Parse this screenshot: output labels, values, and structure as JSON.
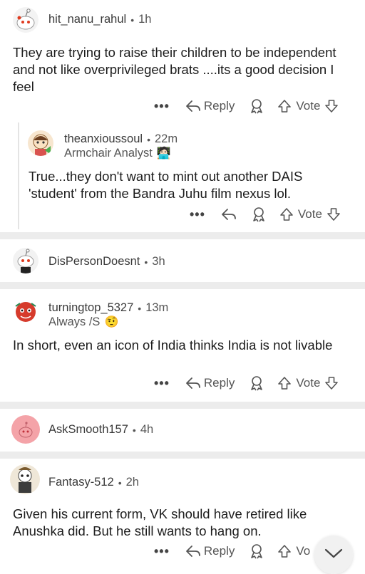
{
  "comments": [
    {
      "username": "hit_nanu_rahul",
      "time": "1h",
      "body": "They are trying to raise their children to be independent and not like overprivileged brats ....its a good decision I feel",
      "reply_label": "Reply",
      "vote_label": "Vote"
    },
    {
      "username": "theanxioussoul",
      "time": "22m",
      "flair": "Armchair Analyst",
      "flair_emoji": "🧑🏻‍💻",
      "body": "True...they don't want to mint out another DAIS 'student' from the Bandra Juhu film nexus lol.",
      "vote_label": "Vote"
    },
    {
      "username": "DisPersonDoesnt",
      "time": "3h"
    },
    {
      "username": "turningtop_5327",
      "time": "13m",
      "flair": "Always /S",
      "flair_emoji": "🤨",
      "body": "In short, even an icon of India thinks India is not livable",
      "reply_label": "Reply",
      "vote_label": "Vote"
    },
    {
      "username": "AskSmooth157",
      "time": "4h"
    },
    {
      "username": "Fantasy-512",
      "time": "2h",
      "body": "Given his current form, VK should have retired like Anushka did. But he still wants to hang on.",
      "reply_label": "Reply",
      "vote_label": "Vo"
    }
  ],
  "ellipsis": "•••",
  "dot": "•"
}
